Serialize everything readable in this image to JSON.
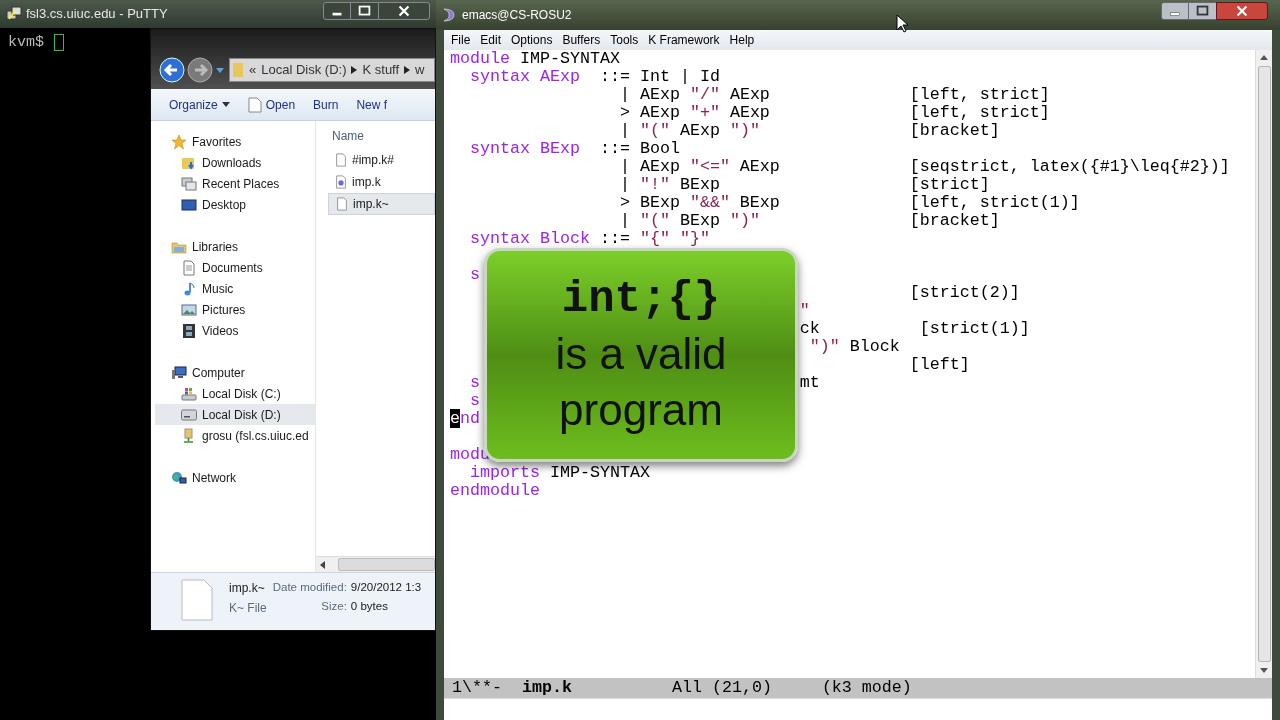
{
  "putty": {
    "title": "fsl3.cs.uiuc.edu - PuTTY",
    "prompt": "kvm$"
  },
  "explorer": {
    "address": {
      "overflow": "«",
      "crumbs": [
        "Local Disk (D:)",
        "K stuff",
        "w"
      ]
    },
    "toolbar": [
      {
        "kind": "dropdown",
        "label": "Organize"
      },
      {
        "kind": "document",
        "label": "Open"
      },
      {
        "kind": "plain",
        "label": "Burn"
      },
      {
        "kind": "plain",
        "label": "New f"
      }
    ],
    "nav": [
      {
        "label": "Favorites",
        "selected": false,
        "children": [
          {
            "label": "Downloads",
            "selected": false
          },
          {
            "label": "Recent Places",
            "selected": false
          },
          {
            "label": "Desktop",
            "selected": false
          }
        ]
      },
      {
        "label": "Libraries",
        "selected": false,
        "children": [
          {
            "label": "Documents",
            "selected": false
          },
          {
            "label": "Music",
            "selected": false
          },
          {
            "label": "Pictures",
            "selected": false
          },
          {
            "label": "Videos",
            "selected": false
          }
        ]
      },
      {
        "label": "Computer",
        "selected": false,
        "children": [
          {
            "label": "Local Disk (C:)",
            "selected": false
          },
          {
            "label": "Local Disk (D:)",
            "selected": true
          },
          {
            "label": "grosu (fsl.cs.uiuc.ed",
            "selected": false
          }
        ]
      },
      {
        "label": "Network",
        "selected": false
      }
    ],
    "files": {
      "column": "Name",
      "items": [
        {
          "name": "#imp.k#",
          "selected": false
        },
        {
          "name": "imp.k",
          "selected": false
        },
        {
          "name": "imp.k~",
          "selected": true
        }
      ]
    },
    "details": {
      "name": "imp.k~",
      "type": "K~ File",
      "fields": [
        {
          "label": "Date modified:",
          "value": "9/20/2012 1:3"
        },
        {
          "label": "Size:",
          "value": "0 bytes"
        }
      ]
    }
  },
  "emacs": {
    "title": "emacs@CS-ROSU2",
    "menu": [
      "File",
      "Edit",
      "Options",
      "Buffers",
      "Tools",
      "K Framework",
      "Help"
    ],
    "blocks": [
      {
        "lines": [
          {
            "tokens": [
              {
                "kind": "keyword",
                "text": "module"
              },
              {
                "kind": "text",
                "text": " IMP-SYNTAX"
              }
            ]
          },
          {
            "tokens": [
              {
                "kind": "keyword",
                "text": "  syntax AExp"
              },
              {
                "kind": "text",
                "text": "  ::= Int | Id"
              }
            ]
          },
          {
            "tokens": [
              {
                "kind": "text",
                "text": "                 | AExp "
              },
              {
                "kind": "string",
                "text": "\"/\""
              },
              {
                "kind": "text",
                "text": " AExp              [left, strict]"
              }
            ]
          },
          {
            "tokens": [
              {
                "kind": "text",
                "text": "                 > AExp "
              },
              {
                "kind": "string",
                "text": "\"+\""
              },
              {
                "kind": "text",
                "text": " AExp              [left, strict]"
              }
            ]
          },
          {
            "tokens": [
              {
                "kind": "text",
                "text": "                 | "
              },
              {
                "kind": "string",
                "text": "\"(\""
              },
              {
                "kind": "text",
                "text": " AExp "
              },
              {
                "kind": "string",
                "text": "\")\""
              },
              {
                "kind": "text",
                "text": "               [bracket]"
              }
            ]
          },
          {
            "tokens": [
              {
                "kind": "keyword",
                "text": "  syntax BExp"
              },
              {
                "kind": "text",
                "text": "  ::= Bool"
              }
            ]
          },
          {
            "tokens": [
              {
                "kind": "text",
                "text": "                 | AExp "
              },
              {
                "kind": "string",
                "text": "\"<=\""
              },
              {
                "kind": "text",
                "text": " AExp             [seqstrict, latex({#1}\\leq{#2})]"
              }
            ]
          },
          {
            "tokens": [
              {
                "kind": "text",
                "text": "                 | "
              },
              {
                "kind": "string",
                "text": "\"!\""
              },
              {
                "kind": "text",
                "text": " BExp                   [strict]"
              }
            ]
          },
          {
            "tokens": [
              {
                "kind": "text",
                "text": "                 > BExp "
              },
              {
                "kind": "string",
                "text": "\"&&\""
              },
              {
                "kind": "text",
                "text": " BExp             [left, strict(1)]"
              }
            ]
          },
          {
            "tokens": [
              {
                "kind": "text",
                "text": "                 | "
              },
              {
                "kind": "string",
                "text": "\"(\""
              },
              {
                "kind": "text",
                "text": " BExp "
              },
              {
                "kind": "string",
                "text": "\")\""
              },
              {
                "kind": "text",
                "text": "               [bracket]"
              }
            ]
          },
          {
            "tokens": [
              {
                "kind": "keyword",
                "text": "  syntax Block"
              },
              {
                "kind": "text",
                "text": " ::= "
              },
              {
                "kind": "string",
                "text": "\"{\" \"}\""
              }
            ]
          }
        ]
      },
      {
        "lines": [
          {
            "tokens": [
              {
                "kind": "keyword",
                "text": "  s"
              }
            ]
          },
          {
            "tokens": [
              {
                "kind": "text",
                "text": "                                              [strict(2)]"
              }
            ]
          },
          {
            "tokens": [
              {
                "kind": "string",
                "text": "                                   \""
              }
            ]
          },
          {
            "tokens": [
              {
                "kind": "text",
                "text": "                                   ck          [strict(1)]"
              }
            ]
          },
          {
            "tokens": [
              {
                "kind": "string",
                "text": "                                    \")\""
              },
              {
                "kind": "text",
                "text": " Block"
              }
            ]
          },
          {
            "tokens": [
              {
                "kind": "text",
                "text": "                                              [left]"
              }
            ]
          },
          {
            "tokens": [
              {
                "kind": "keyword",
                "text": "  s"
              },
              {
                "kind": "text",
                "text": "                                mt"
              }
            ]
          },
          {
            "tokens": [
              {
                "kind": "keyword",
                "text": "  s"
              }
            ]
          },
          {
            "tokens": [
              {
                "kind": "cursor",
                "text": "e"
              },
              {
                "kind": "keyword",
                "text": "nd"
              }
            ]
          }
        ]
      },
      {
        "lines": [
          {
            "tokens": [
              {
                "kind": "keyword",
                "text": "modu"
              }
            ]
          },
          {
            "tokens": [
              {
                "kind": "keyword",
                "text": "  imports"
              },
              {
                "kind": "text",
                "text": " IMP-SYNTAX"
              }
            ]
          },
          {
            "tokens": [
              {
                "kind": "keyword",
                "text": "endmodule"
              }
            ]
          }
        ]
      }
    ],
    "mode_line": [
      {
        "kind": "text",
        "text": "1\\**-  "
      },
      {
        "kind": "bold",
        "text": "imp.k"
      },
      {
        "kind": "text",
        "text": "          All (21,0)     (k3 mode)"
      }
    ],
    "overlay": {
      "lines": [
        {
          "kind": "code",
          "text": "int;{}"
        },
        {
          "kind": "text",
          "text": "is a valid"
        },
        {
          "kind": "text",
          "text": "program"
        }
      ]
    }
  }
}
